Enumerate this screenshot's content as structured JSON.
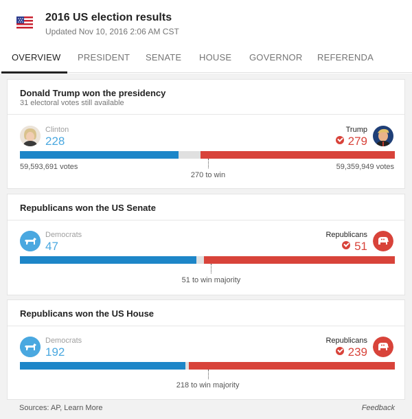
{
  "header": {
    "title": "2016 US election results",
    "updated": "Updated Nov 10, 2016 2:06 AM CST"
  },
  "tabs": [
    {
      "label": "OVERVIEW"
    },
    {
      "label": "PRESIDENT"
    },
    {
      "label": "SENATE"
    },
    {
      "label": "HOUSE"
    },
    {
      "label": "GOVERNOR"
    },
    {
      "label": "REFERENDA"
    }
  ],
  "president": {
    "title": "Donald Trump won the presidency",
    "subtitle": "31 electoral votes still available",
    "left_name": "Clinton",
    "left_value": "228",
    "right_name": "Trump",
    "right_value": "279",
    "left_votes": "59,593,691 votes",
    "right_votes": "59,359,949 votes",
    "threshold_label": "270 to win",
    "total": 538,
    "left_share": 228,
    "right_share": 279,
    "threshold": 270
  },
  "senate": {
    "title": "Republicans won the US Senate",
    "left_name": "Democrats",
    "left_value": "47",
    "right_name": "Republicans",
    "right_value": "51",
    "threshold_label": "51 to win majority",
    "total": 100,
    "left_share": 47,
    "right_share": 51,
    "threshold": 51
  },
  "house": {
    "title": "Republicans won the US House",
    "left_name": "Democrats",
    "left_value": "192",
    "right_name": "Republicans",
    "right_value": "239",
    "threshold_label": "218 to win majority",
    "total": 435,
    "left_share": 192,
    "right_share": 239,
    "threshold": 218
  },
  "footer": {
    "sources": "Sources: AP, Learn More",
    "feedback": "Feedback"
  },
  "colors": {
    "democrat": "#1d86c8",
    "republican": "#d8433a"
  }
}
